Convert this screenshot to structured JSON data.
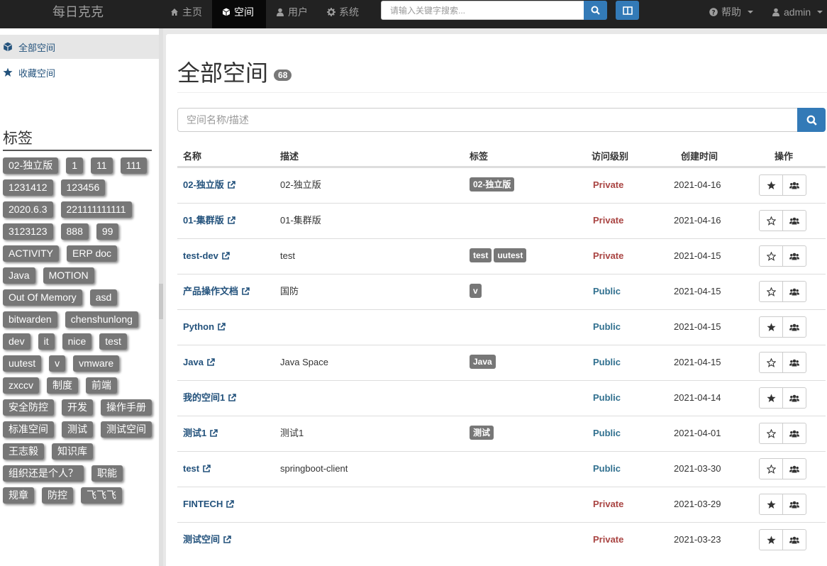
{
  "navbar": {
    "brand": "每日克克",
    "items": [
      {
        "label": "主页",
        "icon": "home-icon"
      },
      {
        "label": "空间",
        "icon": "cube-icon"
      },
      {
        "label": "用户",
        "icon": "user-icon"
      },
      {
        "label": "系统",
        "icon": "gear-icon"
      }
    ],
    "search_placeholder": "请输入关键字搜索...",
    "help_label": "帮助",
    "user_label": "admin"
  },
  "sidebar": {
    "links": [
      {
        "label": "全部空间",
        "icon": "cube-icon"
      },
      {
        "label": "收藏空间",
        "icon": "star-icon"
      }
    ],
    "tags_title": "标签",
    "tags": [
      "02-独立版",
      "1",
      "11",
      "111",
      "1231412",
      "123456",
      "2020.6.3",
      "221111111111",
      "3123123",
      "888",
      "99",
      "ACTIVITY",
      "ERP doc",
      "Java",
      "MOTION",
      "Out Of Memory",
      "asd",
      "bitwarden",
      "chenshunlong",
      "dev",
      "it",
      "nice",
      "test",
      "uutest",
      "v",
      "vmware",
      "zxccv",
      "制度",
      "前端",
      "安全防控",
      "开发",
      "操作手册",
      "标准空间",
      "测试",
      "测试空间",
      "王志毅",
      "知识库",
      "组织还是个人？",
      "职能",
      "规章",
      "防控",
      "飞飞飞"
    ]
  },
  "main": {
    "title": "全部空间",
    "count": "68",
    "filter_placeholder": "空间名称/描述",
    "columns": [
      "名称",
      "描述",
      "标签",
      "访问级别",
      "创建时间",
      "操作"
    ],
    "rows": [
      {
        "name": "02-独立版",
        "desc": "02-独立版",
        "tags": [
          "02-独立版"
        ],
        "level": "Private",
        "date": "2021-04-16",
        "starred": true
      },
      {
        "name": "01-集群版",
        "desc": "01-集群版",
        "tags": [],
        "level": "Private",
        "date": "2021-04-16",
        "starred": false
      },
      {
        "name": "test-dev",
        "desc": "test",
        "tags": [
          "test",
          "uutest"
        ],
        "level": "Private",
        "date": "2021-04-15",
        "starred": false
      },
      {
        "name": "产品操作文档",
        "desc": "国防",
        "tags": [
          "v"
        ],
        "level": "Public",
        "date": "2021-04-15",
        "starred": false
      },
      {
        "name": "Python",
        "desc": "",
        "tags": [],
        "level": "Public",
        "date": "2021-04-15",
        "starred": true
      },
      {
        "name": "Java",
        "desc": "Java Space",
        "tags": [
          "Java"
        ],
        "level": "Public",
        "date": "2021-04-15",
        "starred": false
      },
      {
        "name": "我的空间1",
        "desc": "",
        "tags": [],
        "level": "Public",
        "date": "2021-04-14",
        "starred": true
      },
      {
        "name": "测试1",
        "desc": "测试1",
        "tags": [
          "测试"
        ],
        "level": "Public",
        "date": "2021-04-01",
        "starred": false
      },
      {
        "name": "test",
        "desc": "springboot-client",
        "tags": [],
        "level": "Public",
        "date": "2021-03-30",
        "starred": false
      },
      {
        "name": "FINTECH",
        "desc": "",
        "tags": [],
        "level": "Private",
        "date": "2021-03-29",
        "starred": true
      },
      {
        "name": "测试空间",
        "desc": "",
        "tags": [],
        "level": "Private",
        "date": "2021-03-23",
        "starred": true
      }
    ]
  },
  "colors": {
    "navbar_bg": "#222222",
    "primary": "#337ab7",
    "private": "#a94442",
    "public": "#31708f",
    "tag_bg": "#777777"
  }
}
